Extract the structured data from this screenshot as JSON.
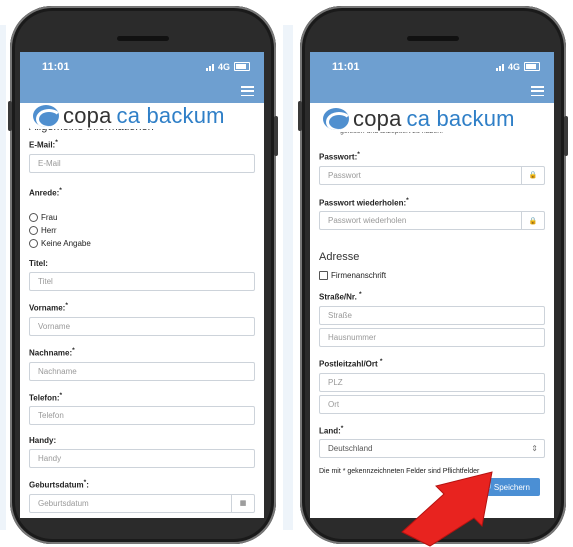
{
  "colors": {
    "header": "#6e9fd0",
    "button": "#4b8fd4",
    "arrow": "#e8231f"
  },
  "left_phone": {
    "time": "11:01",
    "network": "4G",
    "logo": {
      "word1": "copa",
      "word2": "ca backum"
    },
    "section_title": "Allgemeine Informationen",
    "email": {
      "label": "E-Mail:",
      "required": "*",
      "placeholder": "E-Mail"
    },
    "anrede": {
      "label": "Anrede:",
      "required": "*",
      "options": [
        "Frau",
        "Herr",
        "Keine Angabe"
      ]
    },
    "titel": {
      "label": "Titel:",
      "placeholder": "Titel"
    },
    "vorname": {
      "label": "Vorname:",
      "required": "*",
      "placeholder": "Vorname"
    },
    "nachname": {
      "label": "Nachname:",
      "required": "*",
      "placeholder": "Nachname"
    },
    "telefon": {
      "label": "Telefon:",
      "required": "*",
      "placeholder": "Telefon"
    },
    "handy": {
      "label": "Handy:",
      "placeholder": "Handy"
    },
    "geburtsdatum": {
      "label": "Geburtsdatum",
      "required": "*",
      "suffix": ":",
      "placeholder": "Geburtsdatum"
    }
  },
  "right_phone": {
    "time": "11:01",
    "network": "4G",
    "logo": {
      "word1": "copa",
      "word2": "ca backum"
    },
    "partial_text": "gelesen und akzeptiert zu haben. *",
    "passwort": {
      "label": "Passwort:",
      "required": "*",
      "placeholder": "Passwort",
      "icon": "lock-icon"
    },
    "passwort_wdh": {
      "label": "Passwort wiederholen:",
      "required": "*",
      "placeholder": "Passwort wiederholen",
      "icon": "lock-icon"
    },
    "adresse_title": "Adresse",
    "firmenanschrift": "Firmenanschrift",
    "strasse": {
      "label": "Straße/Nr.",
      "required": "*",
      "placeholder1": "Straße",
      "placeholder2": "Hausnummer"
    },
    "plz": {
      "label": "Postleitzahl/Ort",
      "required": "*",
      "placeholder1": "PLZ",
      "placeholder2": "Ort"
    },
    "land": {
      "label": "Land:",
      "required": "*",
      "selected": "Deutschland"
    },
    "note": "Die mit * gekennzeichneten Felder sind Pflichtfelder",
    "save_label": "Speichern",
    "save_icon": "floppy-disk-icon"
  }
}
